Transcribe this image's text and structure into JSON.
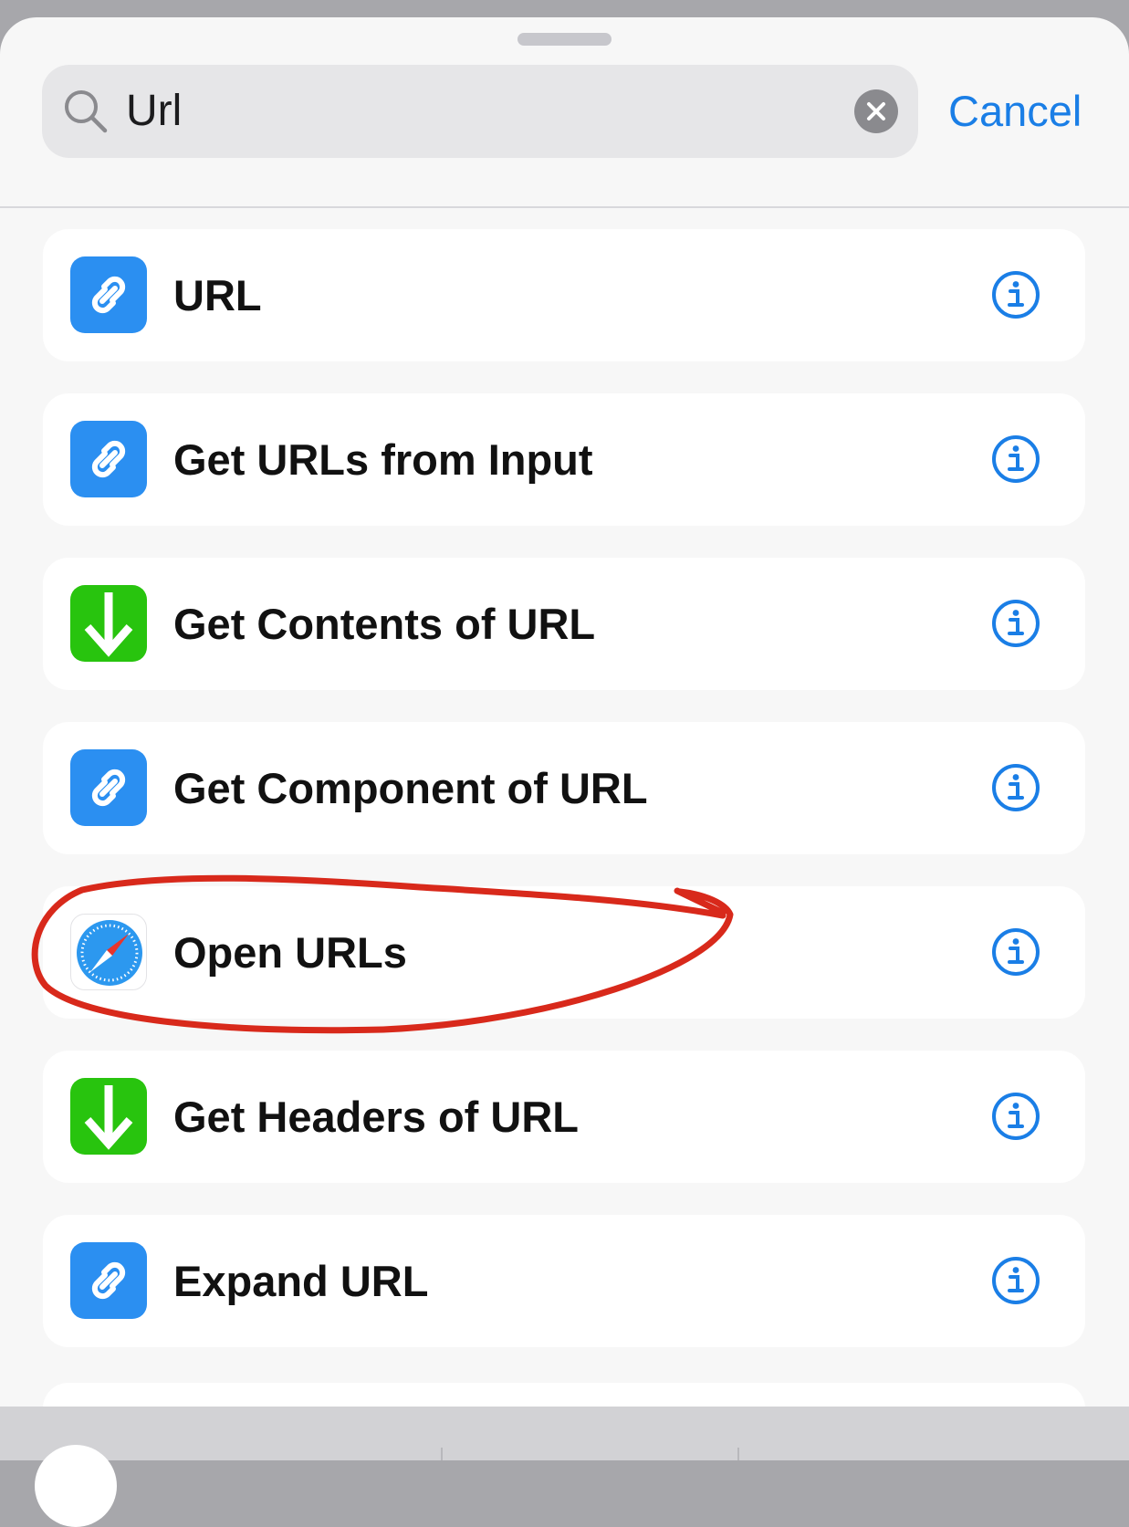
{
  "search": {
    "query": "Url",
    "cancel_label": "Cancel"
  },
  "icons": {
    "search": "search-icon",
    "clear": "clear-search-icon",
    "info": "info-icon",
    "link": "link-icon",
    "download": "download-arrow-icon",
    "safari": "safari-compass-icon"
  },
  "colors": {
    "accent": "#1a7ee6",
    "link_icon_bg": "#2b8ff1",
    "download_icon_bg": "#28c40e",
    "annotation": "#d8291b"
  },
  "results": [
    {
      "title": "URL",
      "icon": "link-icon"
    },
    {
      "title": "Get URLs from Input",
      "icon": "link-icon"
    },
    {
      "title": "Get Contents of URL",
      "icon": "download-arrow-icon"
    },
    {
      "title": "Get Component of URL",
      "icon": "link-icon"
    },
    {
      "title": "Open URLs",
      "icon": "safari-compass-icon",
      "highlighted": true
    },
    {
      "title": "Get Headers of URL",
      "icon": "download-arrow-icon"
    },
    {
      "title": "Expand URL",
      "icon": "link-icon"
    }
  ]
}
